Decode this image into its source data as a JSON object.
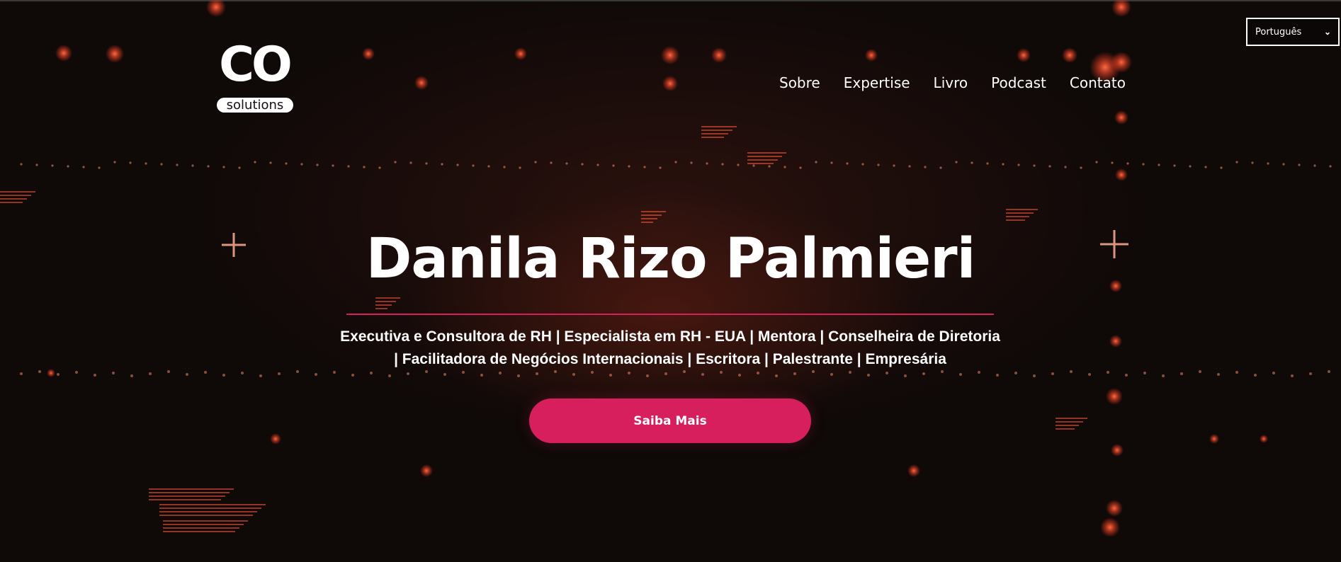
{
  "header": {
    "logo": {
      "mark": "CO",
      "subtext": "solutions"
    },
    "nav": [
      {
        "label": "Sobre"
      },
      {
        "label": "Expertise"
      },
      {
        "label": "Livro"
      },
      {
        "label": "Podcast"
      },
      {
        "label": "Contato"
      }
    ],
    "language_select": {
      "selected": "Português",
      "icon": "chevron-down-icon"
    }
  },
  "hero": {
    "title": "Danila Rizo Palmieri",
    "subtitle_line1": "Executiva e Consultora de RH | Especialista em RH - EUA | Mentora | Conselheira de Diretoria",
    "subtitle_line2": "| Facilitadora de Negócios Internacionais | Escritora | Palestrante | Empresária",
    "cta_label": "Saiba Mais"
  },
  "colors": {
    "accent": "#d61f5c",
    "background": "#150d0c",
    "glow": "#ff5a36",
    "text": "#ffffff"
  }
}
